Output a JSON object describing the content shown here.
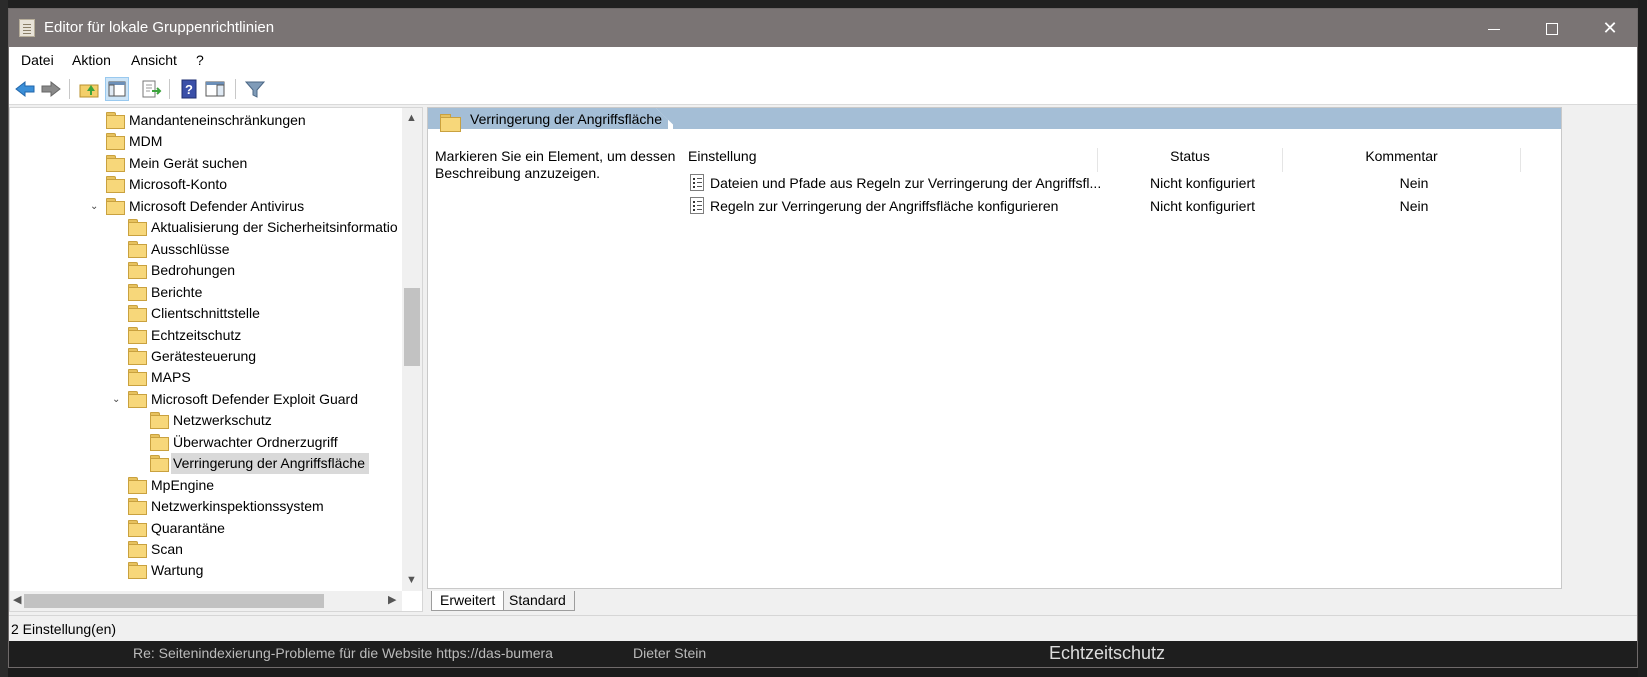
{
  "window": {
    "title": "Editor für lokale Gruppenrichtlinien"
  },
  "menu": [
    "Datei",
    "Aktion",
    "Ansicht",
    "?"
  ],
  "tree": {
    "items": [
      {
        "label": "Mandanteneinschränkungen",
        "level": 0,
        "expanded": false
      },
      {
        "label": "MDM",
        "level": 0,
        "expanded": false
      },
      {
        "label": "Mein Gerät suchen",
        "level": 0,
        "expanded": false
      },
      {
        "label": "Microsoft-Konto",
        "level": 0,
        "expanded": false
      },
      {
        "label": "Microsoft Defender Antivirus",
        "level": 0,
        "expanded": true
      },
      {
        "label": "Aktualisierung der Sicherheitsinformatio",
        "level": 1,
        "expanded": false
      },
      {
        "label": "Ausschlüsse",
        "level": 1,
        "expanded": false
      },
      {
        "label": "Bedrohungen",
        "level": 1,
        "expanded": false
      },
      {
        "label": "Berichte",
        "level": 1,
        "expanded": false
      },
      {
        "label": "Clientschnittstelle",
        "level": 1,
        "expanded": false
      },
      {
        "label": "Echtzeitschutz",
        "level": 1,
        "expanded": false
      },
      {
        "label": "Gerätesteuerung",
        "level": 1,
        "expanded": false
      },
      {
        "label": "MAPS",
        "level": 1,
        "expanded": false
      },
      {
        "label": "Microsoft Defender Exploit Guard",
        "level": 1,
        "expanded": true
      },
      {
        "label": "Netzwerkschutz",
        "level": 2,
        "expanded": false
      },
      {
        "label": "Überwachter Ordnerzugriff",
        "level": 2,
        "expanded": false
      },
      {
        "label": "Verringerung der Angriffsfläche",
        "level": 2,
        "expanded": false,
        "selected": true
      },
      {
        "label": "MpEngine",
        "level": 1,
        "expanded": false
      },
      {
        "label": "Netzwerkinspektionssystem",
        "level": 1,
        "expanded": false
      },
      {
        "label": "Quarantäne",
        "level": 1,
        "expanded": false
      },
      {
        "label": "Scan",
        "level": 1,
        "expanded": false
      },
      {
        "label": "Wartung",
        "level": 1,
        "expanded": false
      }
    ]
  },
  "content": {
    "header_title": "Verringerung der Angriffsfläche",
    "description": "Markieren Sie ein Element, um dessen Beschreibung anzuzeigen.",
    "columns": {
      "setting": "Einstellung",
      "status": "Status",
      "comment": "Kommentar"
    },
    "rows": [
      {
        "setting": "Dateien und Pfade aus Regeln zur Verringerung der Angriffsfl...",
        "status": "Nicht konfiguriert",
        "comment": "Nein"
      },
      {
        "setting": "Regeln zur Verringerung der Angriffsfläche konfigurieren",
        "status": "Nicht konfiguriert",
        "comment": "Nein"
      }
    ]
  },
  "tabs": {
    "extended": "Erweitert",
    "standard": "Standard"
  },
  "statusbar": {
    "text": "2 Einstellung(en)"
  },
  "background": {
    "text1": "Re: Seitenindexierung-Probleme für die Website https://das-bumera",
    "text2": "Dieter Stein",
    "text3": "Echtzeitschutz"
  }
}
